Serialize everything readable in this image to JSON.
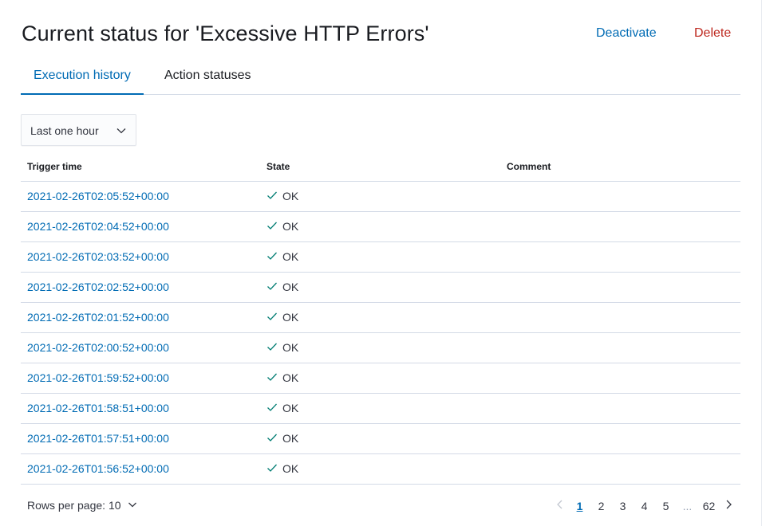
{
  "header": {
    "title": "Current status for 'Excessive HTTP Errors'",
    "deactivate_label": "Deactivate",
    "delete_label": "Delete"
  },
  "tabs": [
    {
      "label": "Execution history",
      "active": true
    },
    {
      "label": "Action statuses",
      "active": false
    }
  ],
  "time_filter": {
    "selected": "Last one hour"
  },
  "table": {
    "columns": [
      "Trigger time",
      "State",
      "Comment"
    ],
    "rows": [
      {
        "time": "2021-02-26T02:05:52+00:00",
        "state": "OK",
        "comment": ""
      },
      {
        "time": "2021-02-26T02:04:52+00:00",
        "state": "OK",
        "comment": ""
      },
      {
        "time": "2021-02-26T02:03:52+00:00",
        "state": "OK",
        "comment": ""
      },
      {
        "time": "2021-02-26T02:02:52+00:00",
        "state": "OK",
        "comment": ""
      },
      {
        "time": "2021-02-26T02:01:52+00:00",
        "state": "OK",
        "comment": ""
      },
      {
        "time": "2021-02-26T02:00:52+00:00",
        "state": "OK",
        "comment": ""
      },
      {
        "time": "2021-02-26T01:59:52+00:00",
        "state": "OK",
        "comment": ""
      },
      {
        "time": "2021-02-26T01:58:51+00:00",
        "state": "OK",
        "comment": ""
      },
      {
        "time": "2021-02-26T01:57:51+00:00",
        "state": "OK",
        "comment": ""
      },
      {
        "time": "2021-02-26T01:56:52+00:00",
        "state": "OK",
        "comment": ""
      }
    ]
  },
  "pagination": {
    "rows_per_page_label": "Rows per page: 10",
    "pages": [
      "1",
      "2",
      "3",
      "4",
      "5",
      "...",
      "62"
    ],
    "current_page": "1"
  },
  "colors": {
    "link": "#006bb4",
    "danger": "#bd271e",
    "success": "#017d73",
    "border": "#d3dae6"
  },
  "icons": {
    "dropdown": "chevron-down-icon",
    "state_ok": "check-icon",
    "prev": "chevron-left-icon",
    "next": "chevron-right-icon"
  }
}
